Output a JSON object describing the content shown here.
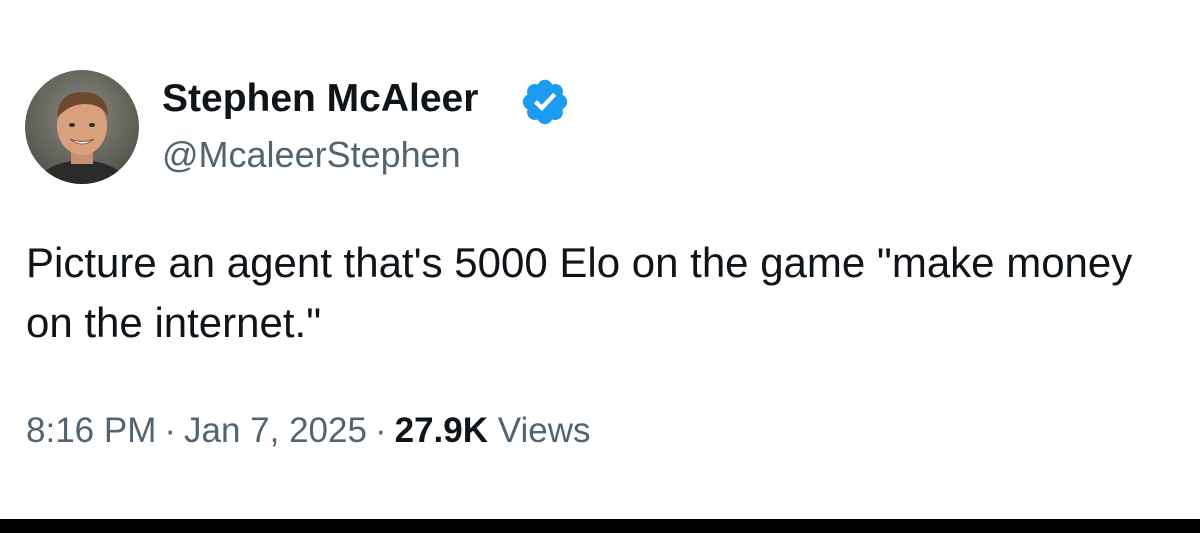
{
  "author": {
    "display_name": "Stephen McAleer",
    "handle": "@McaleerStephen",
    "verified_icon": "verified-badge-icon",
    "avatar_icon": "profile-photo"
  },
  "tweet": {
    "text": "Picture an agent that's 5000 Elo on the game \"make money on the internet.\""
  },
  "meta": {
    "time": "8:16 PM",
    "separator": "·",
    "date": "Jan 7, 2025",
    "views_count": "27.9K",
    "views_label": "Views"
  },
  "colors": {
    "text_primary": "#0f1419",
    "text_secondary": "#536471",
    "verified_blue": "#1d9bf0",
    "background": "#ffffff"
  }
}
